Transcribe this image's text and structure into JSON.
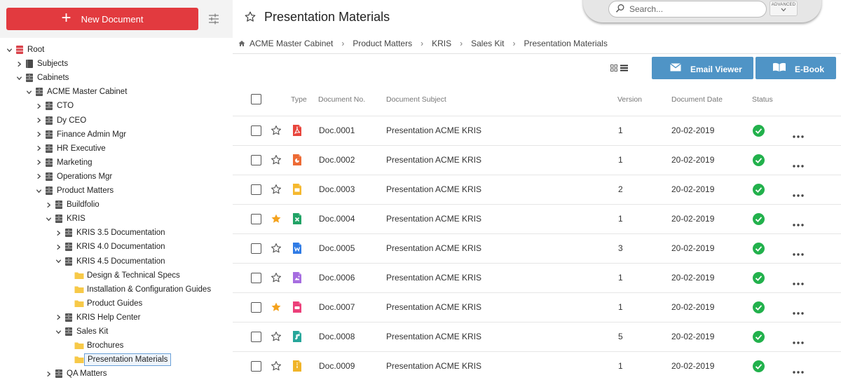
{
  "sidebar": {
    "new_document_label": "New Document",
    "tree": [
      {
        "label": "Root",
        "depth": 0,
        "icon": "root-icon",
        "expanded": true
      },
      {
        "label": "Subjects",
        "depth": 1,
        "icon": "book-icon",
        "expanded": false
      },
      {
        "label": "Cabinets",
        "depth": 1,
        "icon": "cabinet-icon",
        "expanded": true
      },
      {
        "label": "ACME Master Cabinet",
        "depth": 2,
        "icon": "cabinet-icon",
        "expanded": true
      },
      {
        "label": "CTO",
        "depth": 3,
        "icon": "cabinet-icon",
        "expanded": false
      },
      {
        "label": "Dy CEO",
        "depth": 3,
        "icon": "cabinet-icon",
        "expanded": false
      },
      {
        "label": "Finance Admin Mgr",
        "depth": 3,
        "icon": "cabinet-icon",
        "expanded": false
      },
      {
        "label": "HR Executive",
        "depth": 3,
        "icon": "cabinet-icon",
        "expanded": false
      },
      {
        "label": "Marketing",
        "depth": 3,
        "icon": "cabinet-icon",
        "expanded": false
      },
      {
        "label": "Operations Mgr",
        "depth": 3,
        "icon": "cabinet-icon",
        "expanded": false
      },
      {
        "label": "Product Matters",
        "depth": 3,
        "icon": "cabinet-icon",
        "expanded": true
      },
      {
        "label": "Buildfolio",
        "depth": 4,
        "icon": "cabinet-icon",
        "expanded": false
      },
      {
        "label": "KRIS",
        "depth": 4,
        "icon": "cabinet-icon",
        "expanded": true
      },
      {
        "label": "KRIS 3.5 Documentation",
        "depth": 5,
        "icon": "cabinet-icon",
        "expanded": false
      },
      {
        "label": "KRIS 4.0 Documentation",
        "depth": 5,
        "icon": "cabinet-icon",
        "expanded": false
      },
      {
        "label": "KRIS 4.5 Documentation",
        "depth": 5,
        "icon": "cabinet-icon",
        "expanded": true
      },
      {
        "label": "Design & Technical Specs",
        "depth": 6,
        "icon": "folder-icon",
        "leaf": true
      },
      {
        "label": "Installation & Configuration Guides",
        "depth": 6,
        "icon": "folder-icon",
        "leaf": true
      },
      {
        "label": "Product Guides",
        "depth": 6,
        "icon": "folder-icon",
        "leaf": true
      },
      {
        "label": "KRIS Help Center",
        "depth": 5,
        "icon": "cabinet-icon",
        "expanded": false
      },
      {
        "label": "Sales Kit",
        "depth": 5,
        "icon": "cabinet-icon",
        "expanded": true
      },
      {
        "label": "Brochures",
        "depth": 6,
        "icon": "folder-icon",
        "leaf": true
      },
      {
        "label": "Presentation Materials",
        "depth": 6,
        "icon": "folder-icon",
        "leaf": true,
        "selected": true
      },
      {
        "label": "QA Matters",
        "depth": 4,
        "icon": "cabinet-icon",
        "expanded": false
      }
    ]
  },
  "header": {
    "title": "Presentation Materials",
    "search_placeholder": "Search...",
    "advanced_label": "ADVANCED"
  },
  "breadcrumb": [
    "ACME Master Cabinet",
    "Product Matters",
    "KRIS",
    "Sales Kit",
    "Presentation Materials"
  ],
  "toolbar": {
    "email_viewer_label": "Email Viewer",
    "ebook_label": "E-Book"
  },
  "table": {
    "headers": {
      "type": "Type",
      "doc_no": "Document No.",
      "subject": "Document Subject",
      "version": "Version",
      "date": "Document Date",
      "status": "Status"
    },
    "rows": [
      {
        "starred": false,
        "type": "pdf",
        "doc_no": "Doc.0001",
        "subject": "Presentation ACME KRIS",
        "version": "1",
        "date": "20-02-2019",
        "status": "ok"
      },
      {
        "starred": false,
        "type": "powerpoint",
        "doc_no": "Doc.0002",
        "subject": "Presentation ACME KRIS",
        "version": "1",
        "date": "20-02-2019",
        "status": "ok"
      },
      {
        "starred": false,
        "type": "slides",
        "doc_no": "Doc.0003",
        "subject": "Presentation ACME KRIS",
        "version": "2",
        "date": "20-02-2019",
        "status": "ok"
      },
      {
        "starred": true,
        "type": "excel",
        "doc_no": "Doc.0004",
        "subject": "Presentation ACME KRIS",
        "version": "1",
        "date": "20-02-2019",
        "status": "ok"
      },
      {
        "starred": false,
        "type": "word",
        "doc_no": "Doc.0005",
        "subject": "Presentation ACME KRIS",
        "version": "3",
        "date": "20-02-2019",
        "status": "ok"
      },
      {
        "starred": false,
        "type": "image",
        "doc_no": "Doc.0006",
        "subject": "Presentation ACME KRIS",
        "version": "1",
        "date": "20-02-2019",
        "status": "ok"
      },
      {
        "starred": true,
        "type": "video",
        "doc_no": "Doc.0007",
        "subject": "Presentation ACME KRIS",
        "version": "1",
        "date": "20-02-2019",
        "status": "ok"
      },
      {
        "starred": false,
        "type": "audio",
        "doc_no": "Doc.0008",
        "subject": "Presentation ACME KRIS",
        "version": "5",
        "date": "20-02-2019",
        "status": "ok"
      },
      {
        "starred": false,
        "type": "archive",
        "doc_no": "Doc.0009",
        "subject": "Presentation ACME KRIS",
        "version": "1",
        "date": "20-02-2019",
        "status": "ok"
      }
    ]
  },
  "colors": {
    "accent_red": "#e23a3f",
    "button_blue": "#4f94c6",
    "status_green": "#22b14c",
    "star_gold": "#f4a21d",
    "folder_yellow": "#f7c948",
    "type_colors": {
      "pdf": "#e8453c",
      "powerpoint": "#ed6b35",
      "slides": "#f5b82e",
      "excel": "#21a366",
      "word": "#2f7be5",
      "image": "#a66de0",
      "video": "#ec407a",
      "audio": "#26a69a",
      "archive": "#f0b429"
    }
  }
}
